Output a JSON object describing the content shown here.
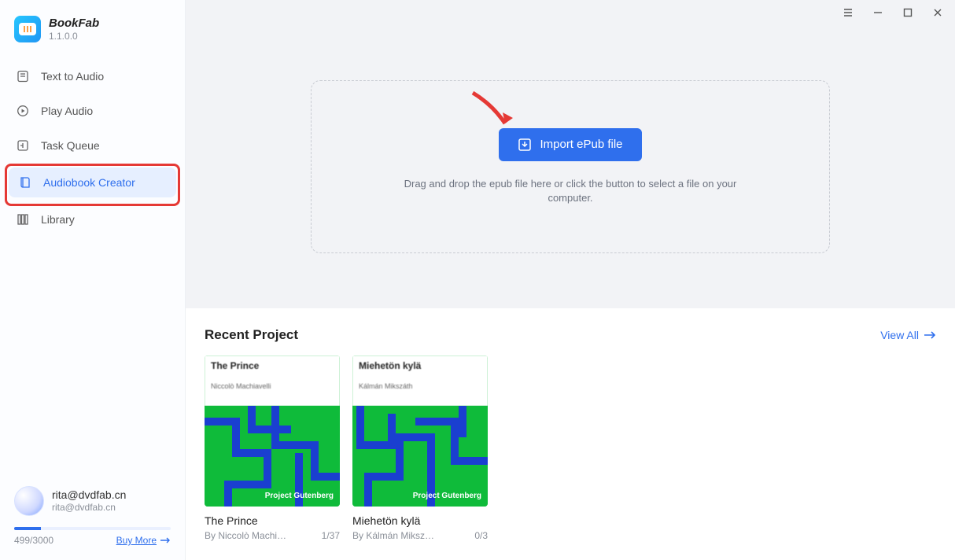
{
  "brand": {
    "name": "BookFab",
    "version": "1.1.0.0"
  },
  "nav": {
    "text_to_audio": "Text to Audio",
    "play_audio": "Play Audio",
    "task_queue": "Task Queue",
    "audiobook_creator": "Audiobook Creator",
    "library": "Library"
  },
  "user": {
    "email": "rita@dvdfab.cn",
    "sub": "rita@dvdfab.cn",
    "quota": "499/3000",
    "buy_more": "Buy More"
  },
  "drop": {
    "import_label": "Import ePub file",
    "help": "Drag and drop the epub file here or click the button to select a file on your computer."
  },
  "recent": {
    "title": "Recent Project",
    "view_all": "View All",
    "pg_label": "Project Gutenberg",
    "cards": [
      {
        "cover_title": "The Prince",
        "cover_author": "Niccolò Machiavelli",
        "card_title": "The Prince",
        "byline": "By Niccolò Machi…",
        "count": "1/37"
      },
      {
        "cover_title": "Miehetön kylä",
        "cover_author": "Kálmán Mikszáth",
        "card_title": "Miehetön kylä",
        "byline": "By Kálmán Miksz…",
        "count": "0/3"
      }
    ]
  }
}
